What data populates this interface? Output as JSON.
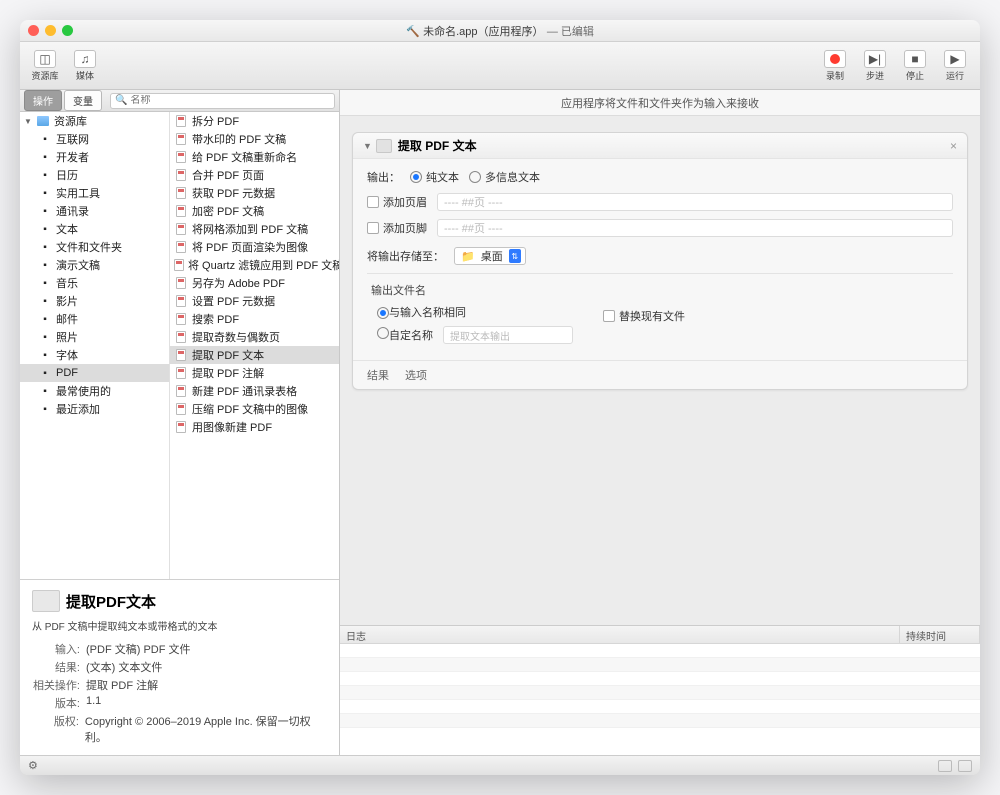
{
  "title": {
    "marker": "🔨",
    "app": "未命名.app（应用程序）",
    "status": "— 已编辑"
  },
  "toolbar": {
    "left": [
      {
        "name": "library-button",
        "icon": "◫",
        "label": "资源库"
      },
      {
        "name": "media-button",
        "icon": "♫",
        "label": "媒体"
      }
    ],
    "right": [
      {
        "name": "record-button",
        "icon": "rec",
        "label": "录制"
      },
      {
        "name": "step-button",
        "icon": "▶|",
        "label": "步进"
      },
      {
        "name": "stop-button",
        "icon": "■",
        "label": "停止"
      },
      {
        "name": "run-button",
        "icon": "▶",
        "label": "运行"
      }
    ]
  },
  "tabs": {
    "actions": "操作",
    "variables": "变量",
    "search_placeholder": "名称"
  },
  "library": {
    "root": "资源库",
    "items": [
      "互联网",
      "开发者",
      "日历",
      "实用工具",
      "通讯录",
      "文本",
      "文件和文件夹",
      "演示文稿",
      "音乐",
      "影片",
      "邮件",
      "照片",
      "字体",
      "PDF",
      "最常使用的",
      "最近添加"
    ],
    "selected": "PDF"
  },
  "actions_list": [
    "拆分 PDF",
    "带水印的 PDF 文稿",
    "给 PDF 文稿重新命名",
    "合并 PDF 页面",
    "获取 PDF 元数据",
    "加密 PDF 文稿",
    "将网格添加到 PDF 文稿",
    "将 PDF 页面渲染为图像",
    "将 Quartz 滤镜应用到 PDF 文稿",
    "另存为 Adobe PDF",
    "设置 PDF 元数据",
    "搜索 PDF",
    "提取奇数与偶数页",
    "提取 PDF 文本",
    "提取 PDF 注解",
    "新建 PDF 通讯录表格",
    "压缩 PDF 文稿中的图像",
    "用图像新建 PDF"
  ],
  "actions_selected": "提取 PDF 文本",
  "info": {
    "title": "提取PDF文本",
    "desc": "从 PDF 文稿中提取纯文本或带格式的文本",
    "rows": [
      {
        "k": "输入:",
        "v": "(PDF 文稿) PDF 文件"
      },
      {
        "k": "结果:",
        "v": "(文本) 文本文件"
      },
      {
        "k": "相关操作:",
        "v": "提取 PDF 注解"
      },
      {
        "k": "版本:",
        "v": "1.1"
      },
      {
        "k": "版权:",
        "v": "Copyright © 2006–2019 Apple Inc. 保留一切权利。"
      }
    ]
  },
  "canvas": {
    "hint": "应用程序将文件和文件夹作为输入来接收",
    "action": {
      "title": "提取 PDF 文本",
      "output_label": "输出：",
      "opt_plain": "纯文本",
      "opt_rich": "多信息文本",
      "add_header": "添加页眉",
      "add_footer": "添加页脚",
      "hash_placeholder": "---- ##页 ----",
      "save_to_label": "将输出存储至：",
      "save_target": "桌面",
      "filename_header": "输出文件名",
      "same_as_input": "与输入名称相同",
      "custom_name": "自定名称",
      "custom_placeholder": "提取文本输出",
      "replace_existing": "替换现有文件",
      "results": "结果",
      "options": "选项"
    }
  },
  "log": {
    "c1": "日志",
    "c2": "持续时间"
  }
}
